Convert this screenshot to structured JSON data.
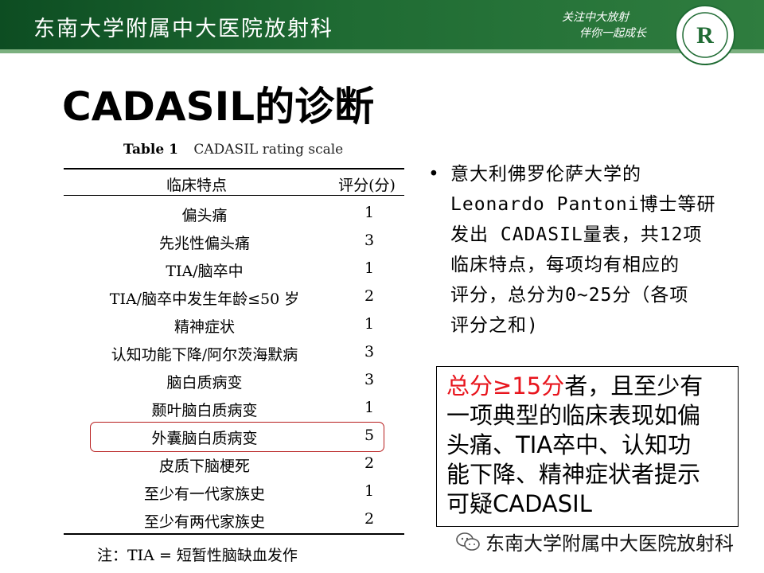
{
  "header": {
    "title": "东南大学附属中大医院放射科",
    "slogan_line1": "关注中大放射",
    "slogan_line2": "伴你一起成长",
    "logo_letter": "R"
  },
  "slide_title": "CADASIL的诊断",
  "table": {
    "caption_label": "Table 1",
    "caption_text": "CADASIL rating scale",
    "headers": {
      "feature": "临床特点",
      "score": "评分(分)"
    },
    "rows": [
      {
        "feature": "偏头痛",
        "score": "1"
      },
      {
        "feature": "先兆性偏头痛",
        "score": "3"
      },
      {
        "feature": "TIA/脑卒中",
        "score": "1"
      },
      {
        "feature": "TIA/脑卒中发生年龄≤50 岁",
        "score": "2"
      },
      {
        "feature": "精神症状",
        "score": "1"
      },
      {
        "feature": "认知功能下降/阿尔茨海默病",
        "score": "3"
      },
      {
        "feature": "脑白质病变",
        "score": "3"
      },
      {
        "feature": "颞叶脑白质病变",
        "score": "1"
      },
      {
        "feature": "外囊脑白质病变",
        "score": "5"
      },
      {
        "feature": "皮质下脑梗死",
        "score": "2"
      },
      {
        "feature": "至少有一代家族史",
        "score": "1"
      },
      {
        "feature": "至少有两代家族史",
        "score": "2"
      }
    ],
    "highlighted_row": "外囊脑白质病变",
    "note": "注：TIA = 短暂性脑缺血发作"
  },
  "bullet": {
    "marker": "•",
    "lines": [
      "意大利佛罗伦萨大学的",
      "Leonardo Pantoni博士等研",
      "发出 CADASIL量表，共12项",
      "临床特点，每项均有相应的",
      "评分，总分为0~25分（各项",
      "评分之和)"
    ]
  },
  "criteria_box": {
    "highlight": "总分≥15分",
    "text_after_highlight": "者，且至少有",
    "lines": [
      "一项典型的临床表现如偏",
      "头痛、TIA卒中、认知功",
      "能下降、精神症状者提示",
      "可疑CADASIL"
    ],
    "highlight_color": "#e8141c"
  },
  "watermark": {
    "text": "东南大学附属中大医院放射科",
    "icon": "wechat-icon"
  },
  "colors": {
    "header_green": "#1f6b33",
    "highlight_border": "#b71c1c"
  }
}
